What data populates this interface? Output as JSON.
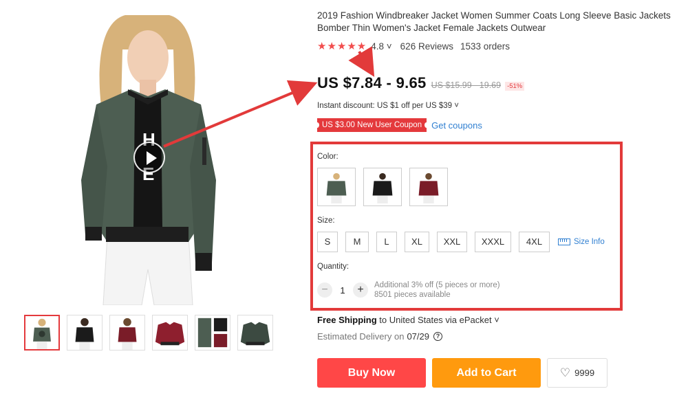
{
  "product": {
    "title": "2019 Fashion Windbreaker Jacket Women Summer Coats Long Sleeve Basic Jackets Bomber Thin Women's Jacket Female Jackets Outwear",
    "stars": "★★★★★",
    "rating": "4.8",
    "reviews": "626 Reviews",
    "orders": "1533 orders",
    "price": "US $7.84 - 9.65",
    "original_price": "US $15.99 - 19.69",
    "discount": "-51%",
    "instant_discount": "Instant discount: US $1 off per US $39",
    "coupon_label": "US $3.00 New User Coupon",
    "get_coupons": "Get coupons"
  },
  "options": {
    "color_label": "Color:",
    "colors": [
      "army-green",
      "black",
      "burgundy"
    ],
    "size_label": "Size:",
    "sizes": [
      "S",
      "M",
      "L",
      "XL",
      "XXL",
      "XXXL",
      "4XL"
    ],
    "size_info": "Size Info",
    "quantity_label": "Quantity:",
    "quantity_minus": "−",
    "quantity": "1",
    "quantity_plus": "+",
    "quantity_offer": "Additional 3% off (5 pieces or more)",
    "available": "8501 pieces available"
  },
  "shipping": {
    "free_shipping": "Free Shipping",
    "destination": "to United States via ePacket",
    "delivery_label": "Estimated Delivery on",
    "delivery_date": "07/29",
    "help_glyph": "?"
  },
  "actions": {
    "buy_now": "Buy Now",
    "add_to_cart": "Add to Cart",
    "wishlist_count": "9999",
    "heart_glyph": "♡"
  },
  "colors": {
    "price_red": "#e4393c",
    "buy_now": "#ff4747",
    "add_to_cart": "#ff9a0e",
    "link_blue": "#2f7fd1",
    "annotation_red": "#e23a3a",
    "jacket_green": "#4d5e52"
  }
}
